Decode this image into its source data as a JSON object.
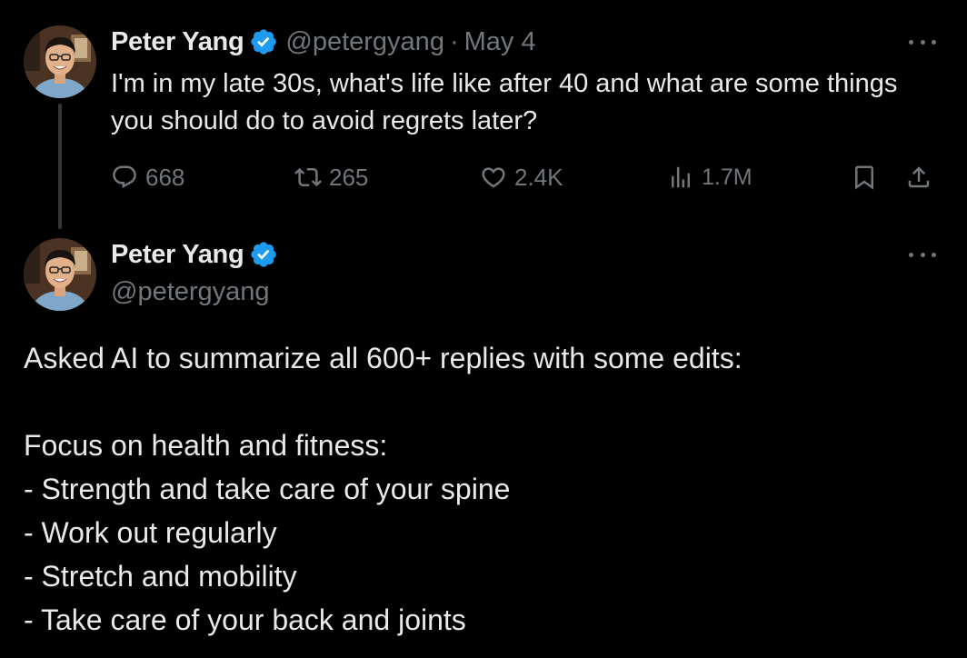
{
  "tweet1": {
    "display_name": "Peter Yang",
    "handle": "@petergyang",
    "separator": "·",
    "date": "May 4",
    "text": "I'm in my late 30s, what's life like after 40 and what are some things you should do to avoid regrets later?",
    "actions": {
      "replies": "668",
      "retweets": "265",
      "likes": "2.4K",
      "views": "1.7M"
    }
  },
  "tweet2": {
    "display_name": "Peter Yang",
    "handle": "@petergyang",
    "intro": "Asked AI to summarize all 600+ replies with some edits:",
    "section_title": "Focus on health and fitness:",
    "items": [
      "- Strength and take care of your spine",
      "- Work out regularly",
      "- Stretch and mobility",
      "- Take care of your back and joints"
    ]
  },
  "icons": {
    "verified": "verified-badge-icon",
    "more": "more-horizontal-icon",
    "reply": "reply-icon",
    "retweet": "retweet-icon",
    "like": "heart-icon",
    "views": "views-icon",
    "bookmark": "bookmark-icon",
    "share": "share-icon"
  },
  "colors": {
    "background": "#000000",
    "text": "#e7e9ea",
    "secondary": "#71767b",
    "verified": "#1d9bf0",
    "thread_line": "#333639"
  }
}
